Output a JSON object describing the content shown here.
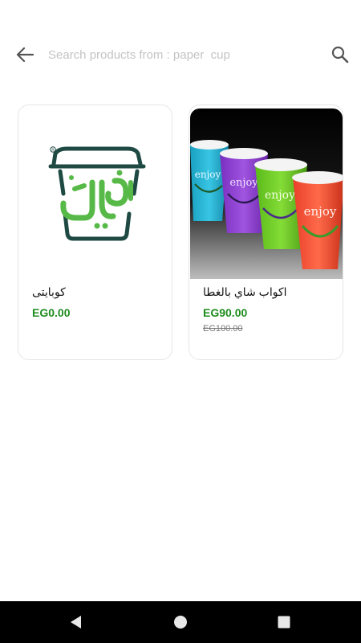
{
  "search": {
    "placeholder": "Search products from : paper  cup",
    "back_icon": "arrow-left-icon",
    "search_icon": "search-icon"
  },
  "products": [
    {
      "name": "كوبايتى",
      "price": "EG0.00",
      "image": "koobayti-logo"
    },
    {
      "name": "اكواب شاي بالغطا",
      "price": "EG90.00",
      "old_price": "EG100.00",
      "image": "colored-paper-cups-photo",
      "cup_text": "enjoy"
    }
  ],
  "colors": {
    "price": "#1e8c1e",
    "logo_green": "#57b947",
    "logo_dark": "#1f4a44"
  },
  "nav": {
    "back_icon": "triangle-back-icon",
    "home_icon": "circle-home-icon",
    "recents_icon": "square-recents-icon"
  }
}
